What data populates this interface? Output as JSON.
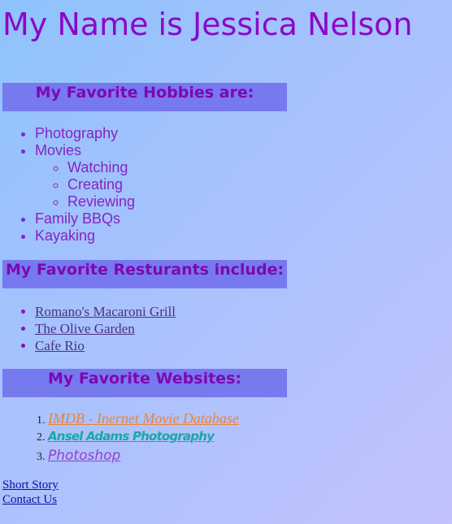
{
  "page": {
    "title": "My Name is Jessica Nelson"
  },
  "hobbies": {
    "heading": "My Favorite Hobbies are:",
    "items": [
      {
        "label": "Photography"
      },
      {
        "label": "Movies",
        "subitems": [
          "Watching",
          "Creating",
          "Reviewing"
        ]
      },
      {
        "label": "Family BBQs"
      },
      {
        "label": "Kayaking"
      }
    ]
  },
  "restaurants": {
    "heading": "My Favorite Resturants include:",
    "items": [
      "Romano's Macaroni Grill",
      "The Olive Garden",
      "Cafe Rio"
    ]
  },
  "websites": {
    "heading": "My Favorite Websites:",
    "items": [
      "IMDB - Inernet Movie Database",
      "Ansel Adams Photography",
      "Photoshop"
    ]
  },
  "footer": {
    "short_story": "Short Story",
    "contact_us": "Contact Us"
  },
  "colors": {
    "title": "#8b08c8",
    "heading_bg": "#7779ee",
    "heading_text": "#7f07b3",
    "hobby_text": "#8723c3",
    "restaurant_link": "#4b2f86",
    "imdb_link": "#e8833a",
    "ansel_link": "#1aa7a6",
    "photoshop_link": "#9a3fd0",
    "footer_link": "#0b0ba6"
  }
}
